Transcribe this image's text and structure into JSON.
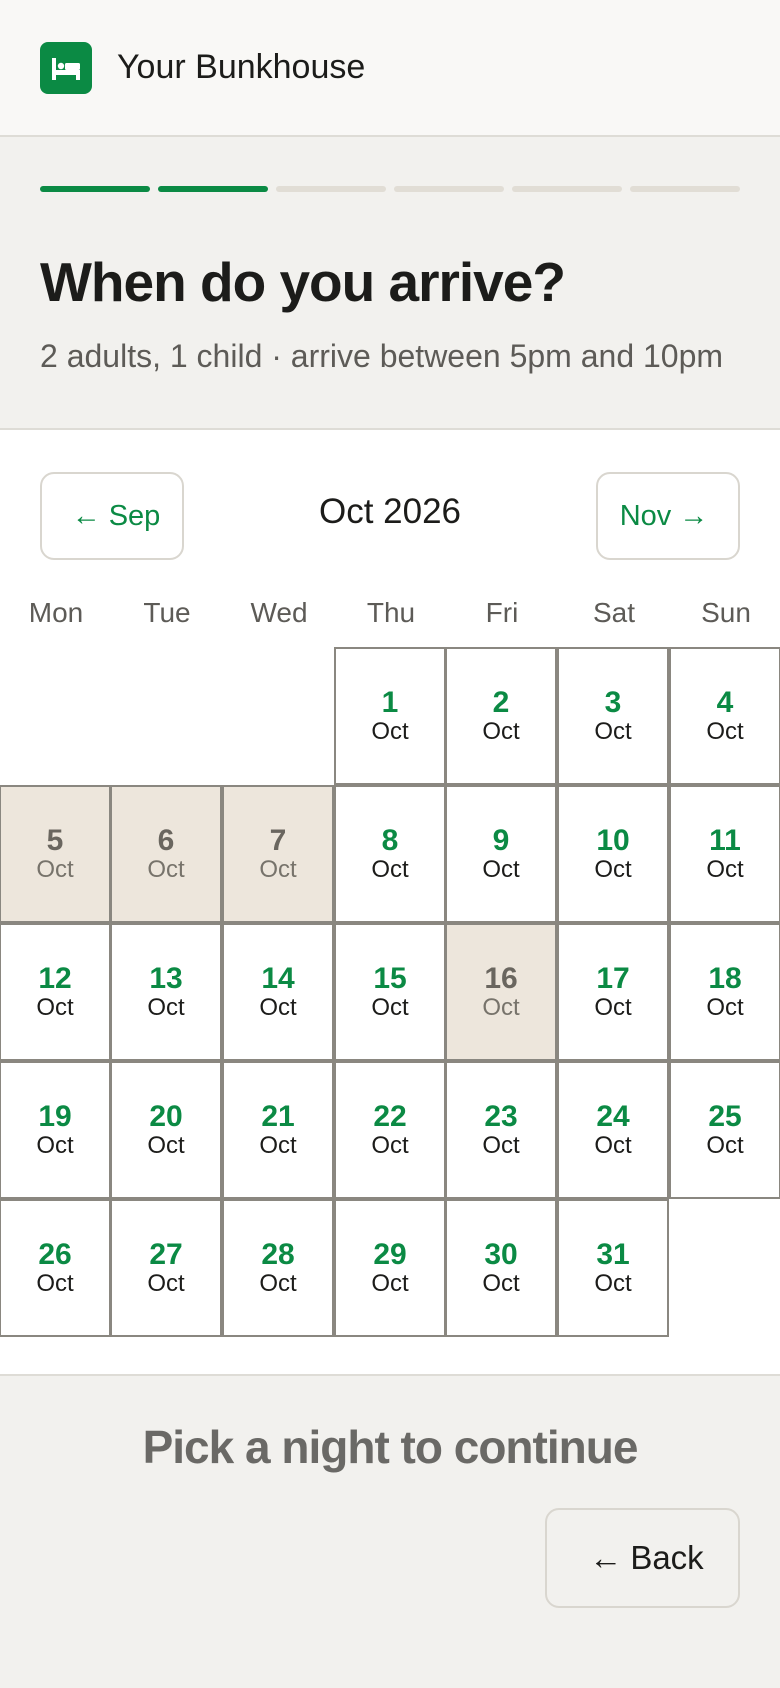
{
  "header": {
    "brand": "Your Bunkhouse",
    "logo_icon": "bed-icon"
  },
  "progress": {
    "total_steps": 6,
    "completed_steps": 2
  },
  "page": {
    "title": "When do you arrive?",
    "subtitle": "2 adults, 1 child · arrive between 5pm and 10pm"
  },
  "calendar": {
    "month_label": "Oct 2026",
    "prev_label": "Sep",
    "next_label": "Nov",
    "weekdays": [
      "Mon",
      "Tue",
      "Wed",
      "Thu",
      "Fri",
      "Sat",
      "Sun"
    ],
    "month_abbr": "Oct",
    "first_weekday_index": 3,
    "days_in_month": 31,
    "unavailable_days": [
      5,
      6,
      7,
      16
    ]
  },
  "footer": {
    "message": "Pick a night to continue",
    "back_label": "Back"
  },
  "colors": {
    "accent": "#0b8a44",
    "unavailable_bg": "#ede6dc"
  }
}
